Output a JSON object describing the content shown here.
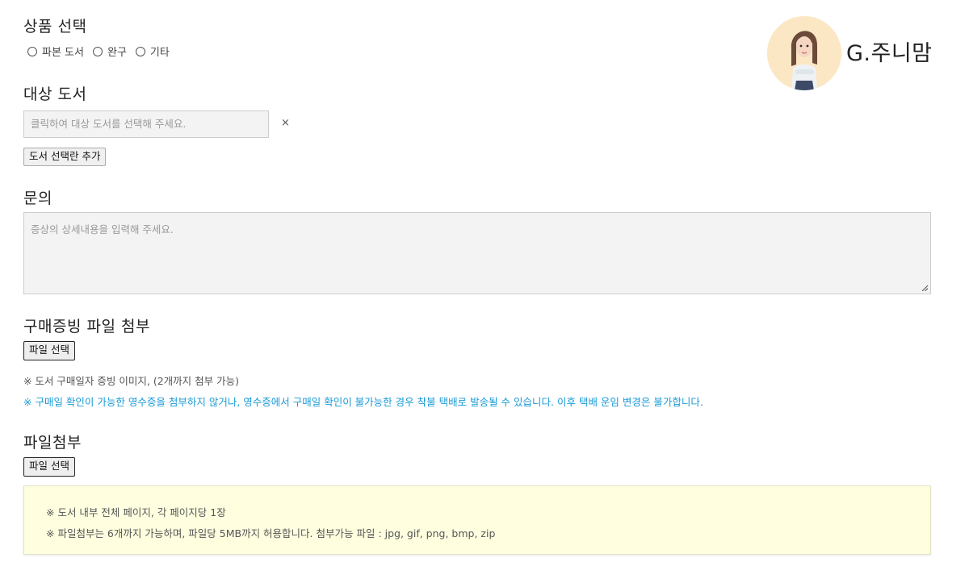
{
  "product": {
    "title": "상품 선택",
    "options": [
      "파본 도서",
      "완구",
      "기타"
    ]
  },
  "book": {
    "title": "대상 도서",
    "placeholder": "클릭하여 대상 도서를 선택해 주세요.",
    "clear": "×",
    "add_button": "도서 선택란 추가"
  },
  "inquiry": {
    "title": "문의",
    "placeholder": "증상의 상세내용을 입력해 주세요."
  },
  "proof": {
    "title": "구매증빙 파일 첨부",
    "file_button": "파일 선택",
    "note1": "※ 도서 구매일자 증빙 이미지, (2개까지 첨부 가능)",
    "note2": "※ 구매일 확인이 가능한 영수증을 첨부하지 않거나, 영수증에서 구매일 확인이 불가능한 경우 착불 택배로 발송될 수 있습니다. 이후 택배 운임 변경은 불가합니다."
  },
  "attach": {
    "title": "파일첨부",
    "file_button": "파일 선택",
    "info1": "※ 도서 내부 전체 페이지, 각 페이지당 1장",
    "info2": "※ 파일첨부는 6개까지 가능하며, 파일당 5MB까지 허용합니다. 첨부가능 파일 : jpg, gif, png, bmp, zip"
  },
  "profile": {
    "name": "G.주니맘"
  },
  "colors": {
    "notice_blue": "#1a9ad6",
    "info_bg": "#ffffe0",
    "avatar_bg": "#fbe7c4"
  }
}
